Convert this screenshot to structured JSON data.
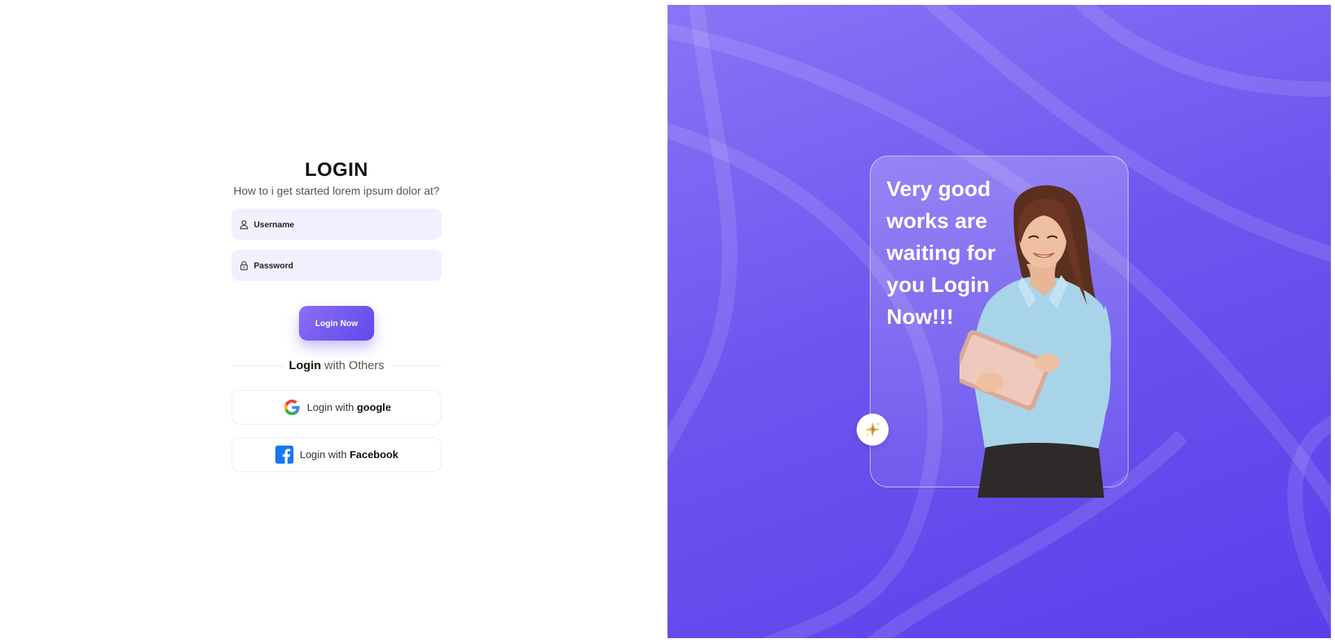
{
  "login": {
    "title": "LOGIN",
    "subtitle": "How to i get started lorem ipsum dolor at?",
    "username_placeholder": "Username",
    "password_placeholder": "Password",
    "submit_label": "Login Now",
    "divider_bold": "Login",
    "divider_rest": "with Others",
    "google_prefix": "Login with",
    "google_name": "google",
    "facebook_prefix": "Login with",
    "facebook_name": "Facebook"
  },
  "promo": {
    "headline": "Very good works are waiting for you Login Now!!!"
  },
  "colors": {
    "accent": "#6a53ee",
    "field_bg": "#f2f0fe",
    "panel_top": "#8a74f6",
    "panel_bottom": "#5a3fea"
  },
  "icons": {
    "username": "user-icon",
    "password": "lock-icon",
    "google": "google-logo-icon",
    "facebook": "facebook-logo-icon",
    "spark": "sparkle-icon"
  }
}
